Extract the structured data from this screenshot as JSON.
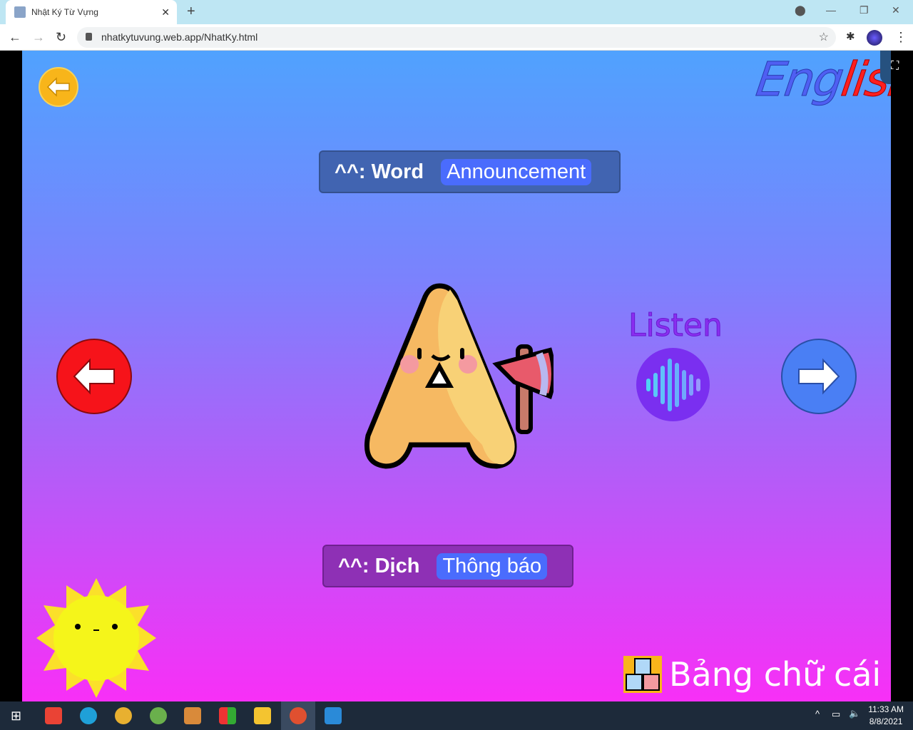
{
  "browser": {
    "tab_title": "Nhật Ký Từ Vựng",
    "url": "nhatkytuvung.web.app/NhatKy.html"
  },
  "page": {
    "logo": {
      "part1": "Eng",
      "part2": "lish"
    },
    "word": {
      "label": "^^: Word",
      "value": "Announcement"
    },
    "translation": {
      "label": "^^: Dịch",
      "value": "Thông báo"
    },
    "listen_label": "Listen",
    "alphabet_link": "Bảng chữ cái",
    "colors": {
      "prev": "#f6131a",
      "next": "#4a7ff4",
      "back": "#f8b51a",
      "listen": "#7a2ff0"
    }
  },
  "taskbar": {
    "time": "11:33 AM",
    "date": "8/8/2021"
  }
}
